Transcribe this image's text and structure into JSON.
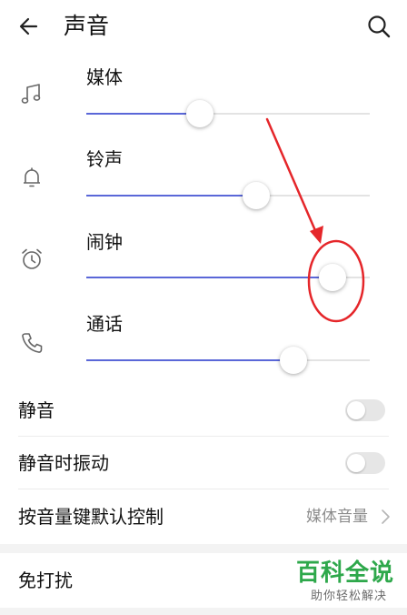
{
  "header": {
    "title": "声音",
    "back_icon": "arrow-left-icon",
    "search_icon": "search-icon"
  },
  "volumes": [
    {
      "label": "媒体",
      "icon": "music-note-icon",
      "level": 0.4
    },
    {
      "label": "铃声",
      "icon": "bell-icon",
      "level": 0.6
    },
    {
      "label": "闹钟",
      "icon": "alarm-clock-icon",
      "level": 0.87
    },
    {
      "label": "通话",
      "icon": "phone-icon",
      "level": 0.73
    }
  ],
  "settings": {
    "mute": {
      "label": "静音",
      "on": false
    },
    "vibrate_on_mute": {
      "label": "静音时振动",
      "on": false
    },
    "volume_key_default": {
      "label": "按音量键默认控制",
      "value": "媒体音量"
    },
    "do_not_disturb": {
      "label": "免打扰"
    }
  },
  "watermark": {
    "main": "百科全说",
    "sub": "助你轻松解决"
  },
  "colors": {
    "accent": "#5a67d8",
    "annotation": "#e5262a",
    "watermark": "#2ea84b"
  }
}
